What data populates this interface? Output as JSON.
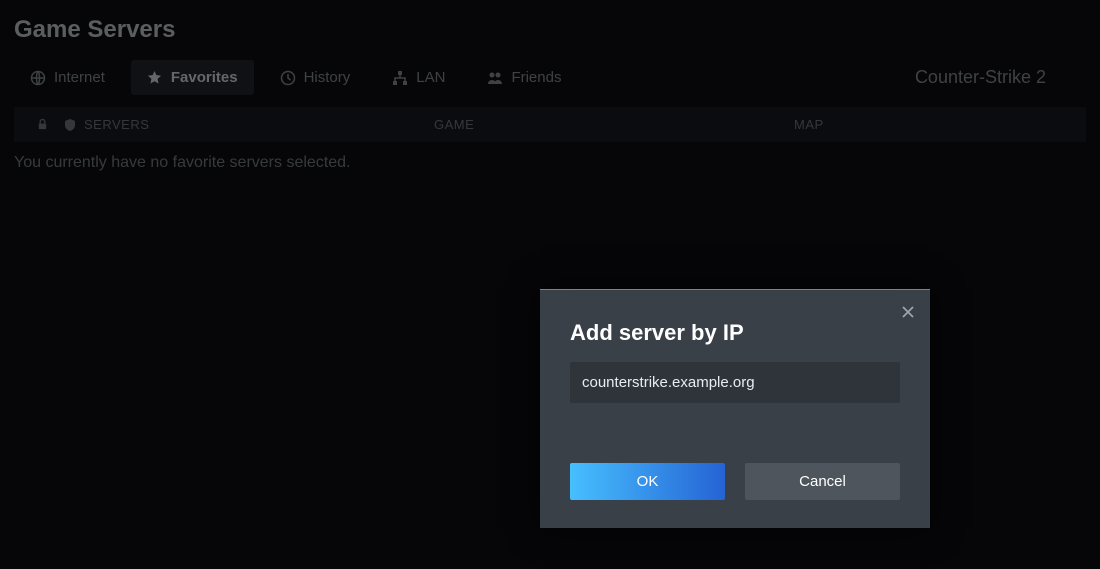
{
  "header": {
    "title": "Game Servers"
  },
  "tabs": {
    "internet": "Internet",
    "favorites": "Favorites",
    "history": "History",
    "lan": "LAN",
    "friends": "Friends"
  },
  "game_selector": {
    "label": "Counter-Strike 2"
  },
  "table": {
    "col_servers": "SERVERS",
    "col_game": "GAME",
    "col_map": "MAP"
  },
  "empty_message": "You currently have no favorite servers selected.",
  "dialog": {
    "title": "Add server by IP",
    "input_value": "counterstrike.example.org",
    "ok_label": "OK",
    "cancel_label": "Cancel"
  }
}
